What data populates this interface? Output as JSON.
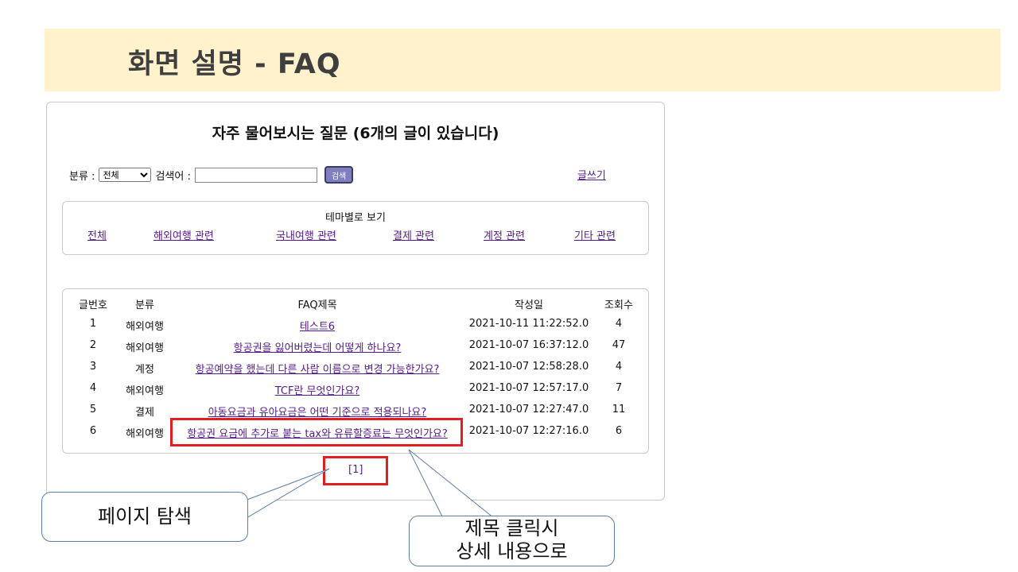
{
  "slide": {
    "title": "화면 설명 - FAQ"
  },
  "page": {
    "heading": "자주 물어보시는 질문 (6개의 글이 있습니다)",
    "search": {
      "category_label": "분류 :",
      "category_value": "전체",
      "keyword_label": "검색어 :",
      "keyword_value": "",
      "button_label": "검색"
    },
    "write_link": "글쓰기",
    "themes": {
      "title": "테마별로 보기",
      "links": [
        "전체",
        "해외여행 관련",
        "국내여행 관련",
        "결제 관련",
        "계정 관련",
        "기타 관련"
      ]
    },
    "table": {
      "columns": [
        "글번호",
        "분류",
        "FAQ제목",
        "작성일",
        "조회수"
      ],
      "rows": [
        [
          "1",
          "해외여행",
          "테스트6",
          "2021-10-11 11:22:52.0",
          "4"
        ],
        [
          "2",
          "해외여행",
          "항공권을 잃어버렸는데 어떻게 하나요?",
          "2021-10-07 16:37:12.0",
          "47"
        ],
        [
          "3",
          "계정",
          "항공예약을 했는데 다른 사람 이름으로 변경 가능한가요?",
          "2021-10-07 12:58:28.0",
          "4"
        ],
        [
          "4",
          "해외여행",
          "TCF란 무엇인가요?",
          "2021-10-07 12:57:17.0",
          "7"
        ],
        [
          "5",
          "결제",
          "아동요금과 유아요금은 어떤 기준으로 적용되나요?",
          "2021-10-07 12:27:47.0",
          "11"
        ],
        [
          "6",
          "해외여행",
          "항공권 요금에 추가로 붙는 tax와 유류할증료는 무엇인가요?",
          "2021-10-07 12:27:16.0",
          "6"
        ]
      ]
    },
    "pager": {
      "current": "[1]"
    }
  },
  "callouts": {
    "page_nav": "페이지 탐색",
    "title_click_line1": "제목 클릭시",
    "title_click_line2": "상세 내용으로"
  },
  "colors": {
    "banner": "#fff2cc",
    "link": "#551a8b",
    "highlight": "#e02020",
    "callout_border": "#5b7dab"
  }
}
